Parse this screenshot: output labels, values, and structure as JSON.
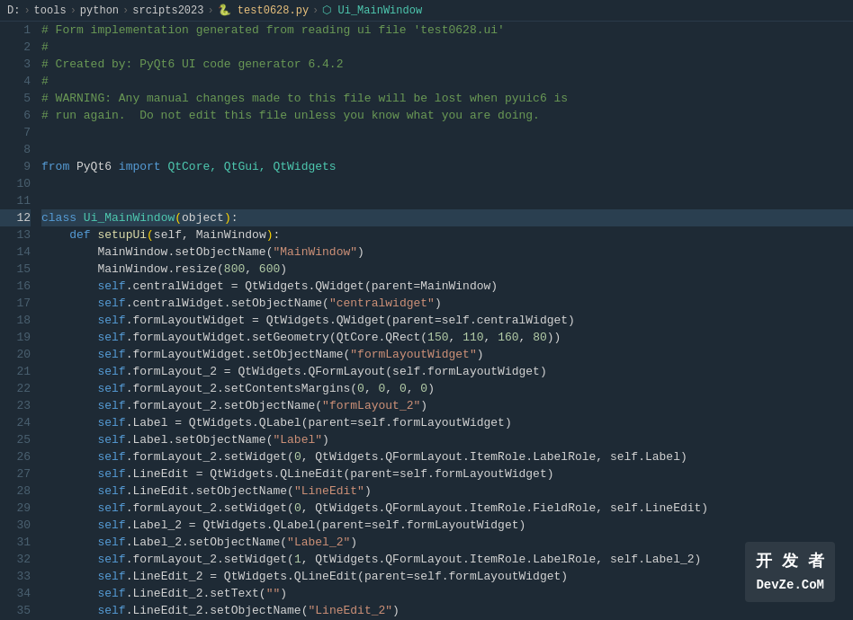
{
  "breadcrumb": {
    "items": [
      {
        "label": "D:",
        "type": "plain"
      },
      {
        "label": "tools",
        "type": "plain"
      },
      {
        "label": "python",
        "type": "plain"
      },
      {
        "label": "srcipts2023",
        "type": "plain"
      },
      {
        "label": "test0628.py",
        "type": "file"
      },
      {
        "label": "Ui_MainWindow",
        "type": "class"
      }
    ]
  },
  "active_line": 12,
  "watermark": {
    "zh": "开 发 者",
    "en": "DevZe.CoM"
  },
  "lines": [
    {
      "num": 1,
      "tokens": [
        {
          "t": "# Form implementation generated from reading ui file 'test0628.ui'",
          "c": "c-comment"
        }
      ]
    },
    {
      "num": 2,
      "tokens": [
        {
          "t": "#",
          "c": "c-comment"
        }
      ]
    },
    {
      "num": 3,
      "tokens": [
        {
          "t": "# Created by: PyQt6 UI code generator 6.4.2",
          "c": "c-comment"
        }
      ]
    },
    {
      "num": 4,
      "tokens": [
        {
          "t": "#",
          "c": "c-comment"
        }
      ]
    },
    {
      "num": 5,
      "tokens": [
        {
          "t": "# WARNING: Any manual changes made to this file will be lost when pyuic6 is",
          "c": "c-comment"
        }
      ]
    },
    {
      "num": 6,
      "tokens": [
        {
          "t": "# run again.  Do not edit this file unless you know what you are doing.",
          "c": "c-comment"
        }
      ]
    },
    {
      "num": 7,
      "tokens": []
    },
    {
      "num": 8,
      "tokens": []
    },
    {
      "num": 9,
      "tokens": [
        {
          "t": "from",
          "c": "c-keyword"
        },
        {
          "t": " PyQt6 ",
          "c": "c-plain"
        },
        {
          "t": "import",
          "c": "c-keyword"
        },
        {
          "t": " QtCore, QtGui, QtWidgets",
          "c": "c-module"
        }
      ]
    },
    {
      "num": 10,
      "tokens": []
    },
    {
      "num": 11,
      "tokens": []
    },
    {
      "num": 12,
      "tokens": [
        {
          "t": "class",
          "c": "c-keyword"
        },
        {
          "t": " ",
          "c": "c-plain"
        },
        {
          "t": "Ui_MainWindow",
          "c": "c-class"
        },
        {
          "t": "(",
          "c": "c-paren"
        },
        {
          "t": "object",
          "c": "c-plain"
        },
        {
          "t": ")",
          "c": "c-paren"
        },
        {
          "t": ":",
          "c": "c-plain"
        }
      ]
    },
    {
      "num": 13,
      "tokens": [
        {
          "t": "    ",
          "c": "c-plain"
        },
        {
          "t": "def",
          "c": "c-keyword"
        },
        {
          "t": " ",
          "c": "c-plain"
        },
        {
          "t": "setupUi",
          "c": "c-func"
        },
        {
          "t": "(",
          "c": "c-paren"
        },
        {
          "t": "self, MainWindow",
          "c": "c-plain"
        },
        {
          "t": ")",
          "c": "c-paren"
        },
        {
          "t": ":",
          "c": "c-plain"
        }
      ]
    },
    {
      "num": 14,
      "tokens": [
        {
          "t": "        MainWindow.setObjectName(",
          "c": "c-plain"
        },
        {
          "t": "\"MainWindow\"",
          "c": "c-string"
        },
        {
          "t": ")",
          "c": "c-plain"
        }
      ]
    },
    {
      "num": 15,
      "tokens": [
        {
          "t": "        MainWindow.resize(",
          "c": "c-plain"
        },
        {
          "t": "800",
          "c": "c-number"
        },
        {
          "t": ", ",
          "c": "c-plain"
        },
        {
          "t": "600",
          "c": "c-number"
        },
        {
          "t": ")",
          "c": "c-plain"
        }
      ]
    },
    {
      "num": 16,
      "tokens": [
        {
          "t": "        ",
          "c": "c-plain"
        },
        {
          "t": "self",
          "c": "c-keyword"
        },
        {
          "t": ".centralWidget = QtWidgets.QWidget(parent=MainWindow)",
          "c": "c-plain"
        }
      ]
    },
    {
      "num": 17,
      "tokens": [
        {
          "t": "        ",
          "c": "c-plain"
        },
        {
          "t": "self",
          "c": "c-keyword"
        },
        {
          "t": ".centralWidget.setObjectName(",
          "c": "c-plain"
        },
        {
          "t": "\"centralwidget\"",
          "c": "c-string"
        },
        {
          "t": ")",
          "c": "c-plain"
        }
      ]
    },
    {
      "num": 18,
      "tokens": [
        {
          "t": "        ",
          "c": "c-plain"
        },
        {
          "t": "self",
          "c": "c-keyword"
        },
        {
          "t": ".formLayoutWidget = QtWidgets.QWidget(parent=self.centralWidget)",
          "c": "c-plain"
        }
      ]
    },
    {
      "num": 19,
      "tokens": [
        {
          "t": "        ",
          "c": "c-plain"
        },
        {
          "t": "self",
          "c": "c-keyword"
        },
        {
          "t": ".formLayoutWidget.setGeometry(QtCore.QRect(",
          "c": "c-plain"
        },
        {
          "t": "150",
          "c": "c-number"
        },
        {
          "t": ", ",
          "c": "c-plain"
        },
        {
          "t": "110",
          "c": "c-number"
        },
        {
          "t": ", ",
          "c": "c-plain"
        },
        {
          "t": "160",
          "c": "c-number"
        },
        {
          "t": ", ",
          "c": "c-plain"
        },
        {
          "t": "80",
          "c": "c-number"
        },
        {
          "t": "))",
          "c": "c-plain"
        }
      ]
    },
    {
      "num": 20,
      "tokens": [
        {
          "t": "        ",
          "c": "c-plain"
        },
        {
          "t": "self",
          "c": "c-keyword"
        },
        {
          "t": ".formLayoutWidget.setObjectName(",
          "c": "c-plain"
        },
        {
          "t": "\"formLayoutWidget\"",
          "c": "c-string"
        },
        {
          "t": ")",
          "c": "c-plain"
        }
      ]
    },
    {
      "num": 21,
      "tokens": [
        {
          "t": "        ",
          "c": "c-plain"
        },
        {
          "t": "self",
          "c": "c-keyword"
        },
        {
          "t": ".formLayout_2 = QtWidgets.QFormLayout(self.formLayoutWidget)",
          "c": "c-plain"
        }
      ]
    },
    {
      "num": 22,
      "tokens": [
        {
          "t": "        ",
          "c": "c-plain"
        },
        {
          "t": "self",
          "c": "c-keyword"
        },
        {
          "t": ".formLayout_2.setContentsMargins(",
          "c": "c-plain"
        },
        {
          "t": "0",
          "c": "c-number"
        },
        {
          "t": ", ",
          "c": "c-plain"
        },
        {
          "t": "0",
          "c": "c-number"
        },
        {
          "t": ", ",
          "c": "c-plain"
        },
        {
          "t": "0",
          "c": "c-number"
        },
        {
          "t": ", ",
          "c": "c-plain"
        },
        {
          "t": "0",
          "c": "c-number"
        },
        {
          "t": ")",
          "c": "c-plain"
        }
      ]
    },
    {
      "num": 23,
      "tokens": [
        {
          "t": "        ",
          "c": "c-plain"
        },
        {
          "t": "self",
          "c": "c-keyword"
        },
        {
          "t": ".formLayout_2.setObjectName(",
          "c": "c-plain"
        },
        {
          "t": "\"formLayout_2\"",
          "c": "c-string"
        },
        {
          "t": ")",
          "c": "c-plain"
        }
      ]
    },
    {
      "num": 24,
      "tokens": [
        {
          "t": "        ",
          "c": "c-plain"
        },
        {
          "t": "self",
          "c": "c-keyword"
        },
        {
          "t": ".Label = QtWidgets.QLabel(parent=self.formLayoutWidget)",
          "c": "c-plain"
        }
      ]
    },
    {
      "num": 25,
      "tokens": [
        {
          "t": "        ",
          "c": "c-plain"
        },
        {
          "t": "self",
          "c": "c-keyword"
        },
        {
          "t": ".Label.setObjectName(",
          "c": "c-plain"
        },
        {
          "t": "\"Label\"",
          "c": "c-string"
        },
        {
          "t": ")",
          "c": "c-plain"
        }
      ]
    },
    {
      "num": 26,
      "tokens": [
        {
          "t": "        ",
          "c": "c-plain"
        },
        {
          "t": "self",
          "c": "c-keyword"
        },
        {
          "t": ".formLayout_2.setWidget(",
          "c": "c-plain"
        },
        {
          "t": "0",
          "c": "c-number"
        },
        {
          "t": ", QtWidgets.QFormLayout.ItemRole.LabelRole, self.Label)",
          "c": "c-plain"
        }
      ]
    },
    {
      "num": 27,
      "tokens": [
        {
          "t": "        ",
          "c": "c-plain"
        },
        {
          "t": "self",
          "c": "c-keyword"
        },
        {
          "t": ".LineEdit = QtWidgets.QLineEdit(parent=self.formLayoutWidget)",
          "c": "c-plain"
        }
      ]
    },
    {
      "num": 28,
      "tokens": [
        {
          "t": "        ",
          "c": "c-plain"
        },
        {
          "t": "self",
          "c": "c-keyword"
        },
        {
          "t": ".LineEdit.setObjectName(",
          "c": "c-plain"
        },
        {
          "t": "\"LineEdit\"",
          "c": "c-string"
        },
        {
          "t": ")",
          "c": "c-plain"
        }
      ]
    },
    {
      "num": 29,
      "tokens": [
        {
          "t": "        ",
          "c": "c-plain"
        },
        {
          "t": "self",
          "c": "c-keyword"
        },
        {
          "t": ".formLayout_2.setWidget(",
          "c": "c-plain"
        },
        {
          "t": "0",
          "c": "c-number"
        },
        {
          "t": ", QtWidgets.QFormLayout.ItemRole.FieldRole, self.LineEdit)",
          "c": "c-plain"
        }
      ]
    },
    {
      "num": 30,
      "tokens": [
        {
          "t": "        ",
          "c": "c-plain"
        },
        {
          "t": "self",
          "c": "c-keyword"
        },
        {
          "t": ".Label_2 = QtWidgets.QLabel(parent=self.formLayoutWidget)",
          "c": "c-plain"
        }
      ]
    },
    {
      "num": 31,
      "tokens": [
        {
          "t": "        ",
          "c": "c-plain"
        },
        {
          "t": "self",
          "c": "c-keyword"
        },
        {
          "t": ".Label_2.setObjectName(",
          "c": "c-plain"
        },
        {
          "t": "\"Label_2\"",
          "c": "c-string"
        },
        {
          "t": ")",
          "c": "c-plain"
        }
      ]
    },
    {
      "num": 32,
      "tokens": [
        {
          "t": "        ",
          "c": "c-plain"
        },
        {
          "t": "self",
          "c": "c-keyword"
        },
        {
          "t": ".formLayout_2.setWidget(",
          "c": "c-plain"
        },
        {
          "t": "1",
          "c": "c-number"
        },
        {
          "t": ", QtWidgets.QFormLayout.ItemRole.LabelRole, self.Label_2)",
          "c": "c-plain"
        }
      ]
    },
    {
      "num": 33,
      "tokens": [
        {
          "t": "        ",
          "c": "c-plain"
        },
        {
          "t": "self",
          "c": "c-keyword"
        },
        {
          "t": ".LineEdit_2 = QtWidgets.QLineEdit(parent=self.formLayoutWidget)",
          "c": "c-plain"
        }
      ]
    },
    {
      "num": 34,
      "tokens": [
        {
          "t": "        ",
          "c": "c-plain"
        },
        {
          "t": "self",
          "c": "c-keyword"
        },
        {
          "t": ".LineEdit_2.setText(",
          "c": "c-plain"
        },
        {
          "t": "\"\"",
          "c": "c-string"
        },
        {
          "t": ")",
          "c": "c-plain"
        }
      ]
    },
    {
      "num": 35,
      "tokens": [
        {
          "t": "        ",
          "c": "c-plain"
        },
        {
          "t": "self",
          "c": "c-keyword"
        },
        {
          "t": ".LineEdit_2.setObjectName(",
          "c": "c-plain"
        },
        {
          "t": "\"LineEdit_2\"",
          "c": "c-string"
        },
        {
          "t": ")",
          "c": "c-plain"
        }
      ]
    }
  ]
}
